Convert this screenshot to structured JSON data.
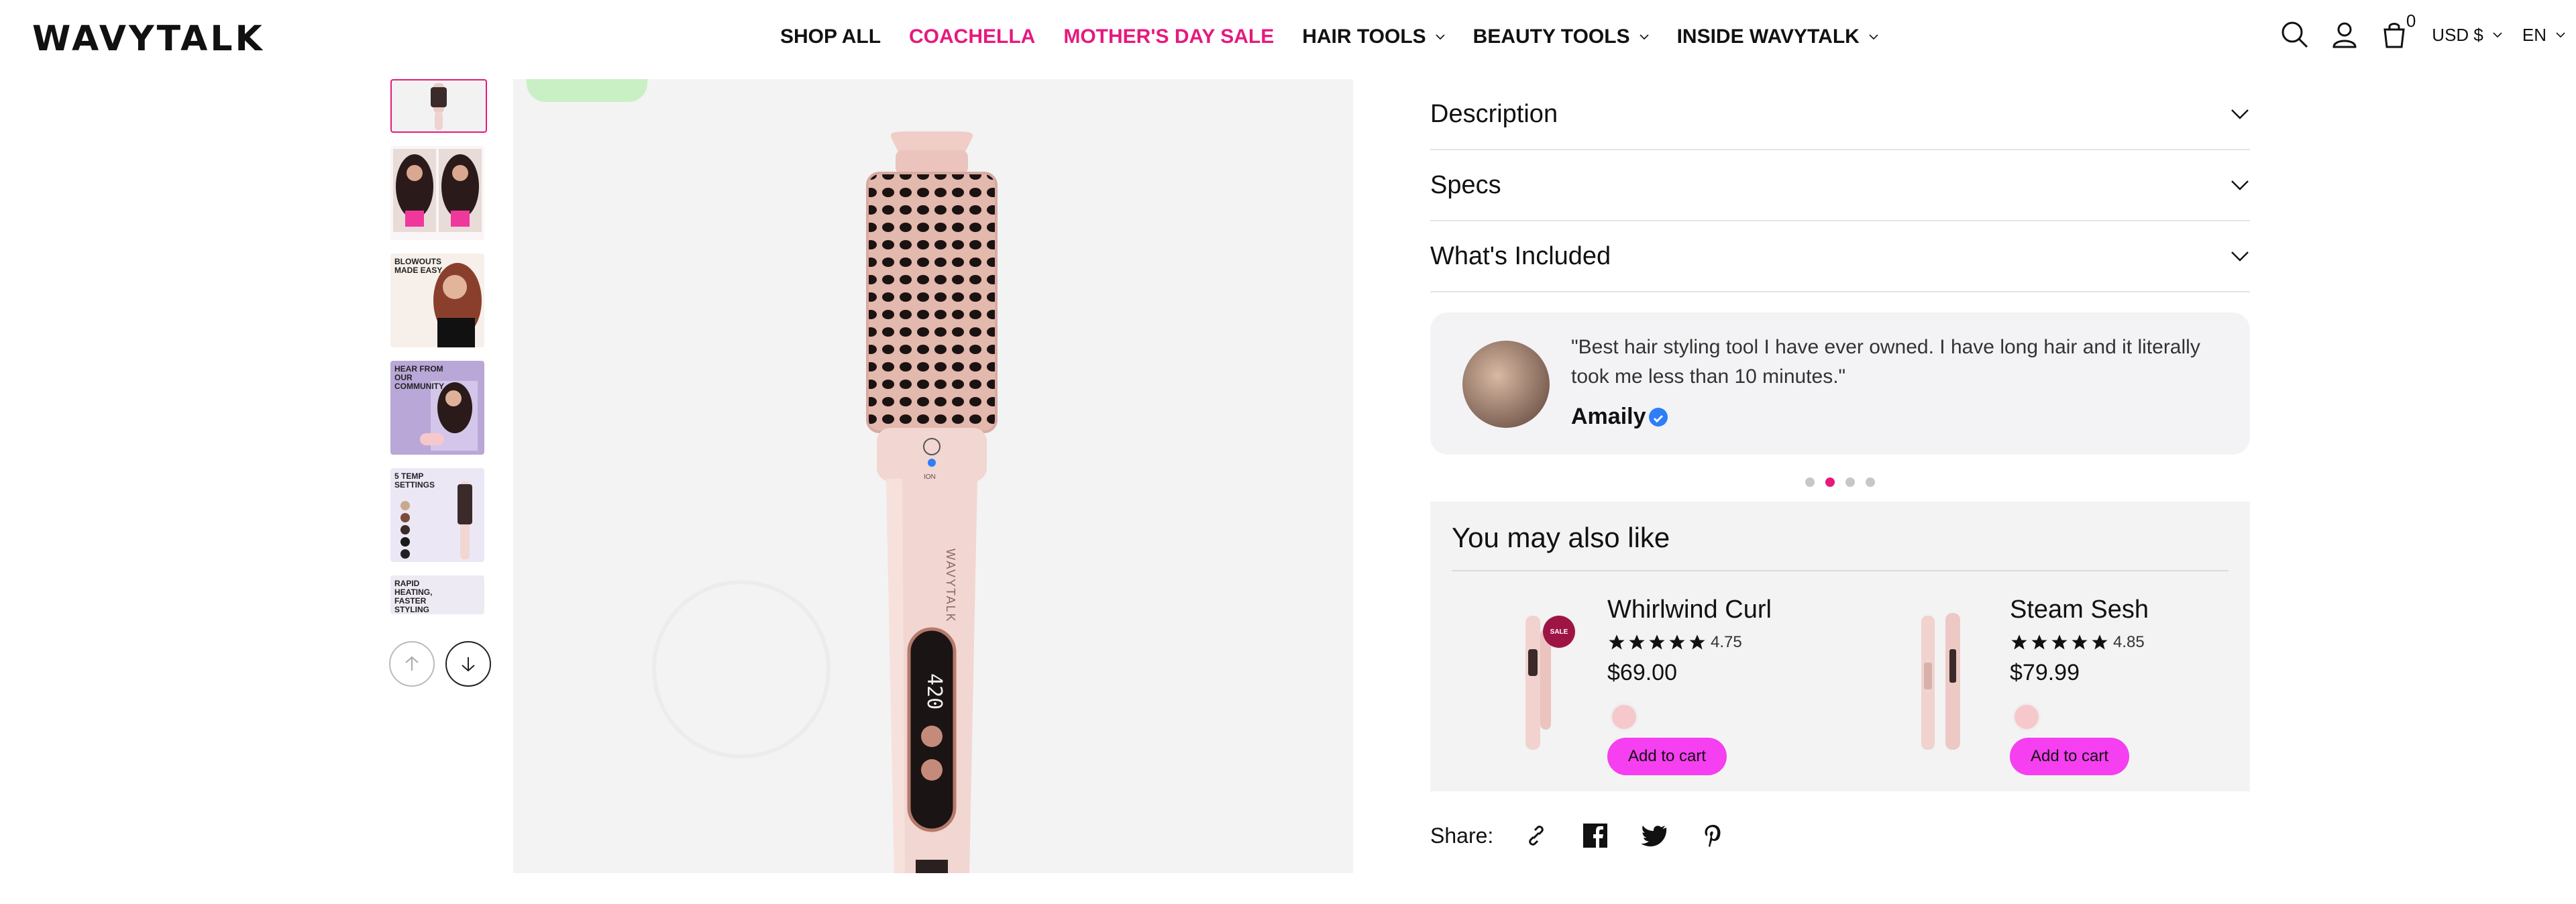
{
  "header": {
    "logo": "WAVYTALK",
    "nav": [
      {
        "label": "SHOP ALL",
        "color": "#111111",
        "dropdown": false
      },
      {
        "label": "COACHELLA",
        "color": "#e6197e",
        "dropdown": false
      },
      {
        "label": "MOTHER'S DAY SALE",
        "color": "#e6197e",
        "dropdown": false
      },
      {
        "label": "HAIR TOOLS",
        "color": "#111111",
        "dropdown": true
      },
      {
        "label": "BEAUTY TOOLS",
        "color": "#111111",
        "dropdown": true
      },
      {
        "label": "INSIDE WAVYTALK",
        "color": "#111111",
        "dropdown": true
      }
    ],
    "cart_count": "0",
    "currency": "USD $",
    "language": "EN",
    "icons": [
      "search-icon",
      "account-icon",
      "cart-icon"
    ]
  },
  "thumbnails": [
    {
      "name": "product-front",
      "label": "",
      "bg": "#f2f2f2"
    },
    {
      "name": "before-after",
      "label": "",
      "bg": "#8a4a5a"
    },
    {
      "name": "blowouts-made-easy",
      "label": "BLOWOUTS MADE EASY",
      "bg": "#f7f0ea"
    },
    {
      "name": "hear-from-community",
      "label": "HEAR FROM OUR COMMUNITY",
      "bg": "#b9a7d8"
    },
    {
      "name": "temp-settings",
      "label": "5 TEMP SETTINGS",
      "bg": "#ece7f5"
    },
    {
      "name": "rapid-heating",
      "label": "RAPID HEATING, FASTER STYLING",
      "bg": "#eeeaf4"
    }
  ],
  "main_image": {
    "brand_on_handle": "WAVYTALK",
    "display_value": "420",
    "ion_label": "ION"
  },
  "accordions": [
    {
      "title": "Description"
    },
    {
      "title": "Specs"
    },
    {
      "title": "What's Included"
    }
  ],
  "review": {
    "quote": "\"Best hair styling tool I have ever owned. I have long hair and it literally took me less than 10 minutes.\"",
    "author": "Amaily"
  },
  "carousel": {
    "count": 4,
    "active": 1
  },
  "also_like": {
    "title": "You may also like",
    "products": [
      {
        "name": "Whirlwind Curl",
        "rating": "4.75",
        "stars": 5,
        "price": "$69.00",
        "swatch": "#f6c8cc",
        "button": "Add to cart",
        "badge": "SALE"
      },
      {
        "name": "Steam Sesh",
        "rating": "4.85",
        "stars": 5,
        "price": "$79.99",
        "swatch": "#f6c8cc",
        "button": "Add to cart",
        "badge": ""
      }
    ]
  },
  "share": {
    "label": "Share:",
    "icons": [
      "link-icon",
      "facebook-icon",
      "twitter-icon",
      "pinterest-icon"
    ]
  },
  "colors": {
    "accent": "#e6197e",
    "button": "#f53ff0",
    "badge_green": "#c9f0c5",
    "panel_bg": "#f3f3f3"
  }
}
